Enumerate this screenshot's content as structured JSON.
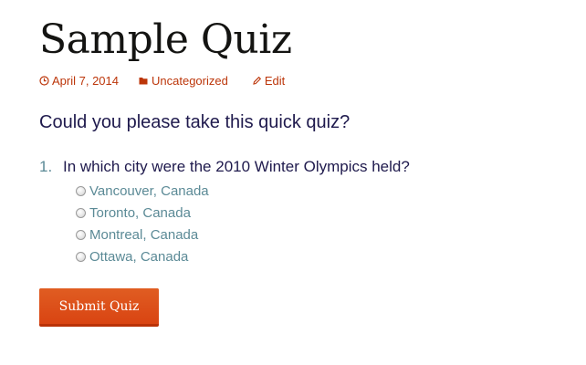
{
  "post": {
    "title": "Sample Quiz",
    "date": "April 7, 2014",
    "category": "Uncategorized",
    "edit_label": "Edit"
  },
  "quiz": {
    "intro": "Could you please take this quick quiz?",
    "questions": [
      {
        "number": "1.",
        "text": "In which city were the 2010 Winter Olympics held?",
        "options": [
          "Vancouver, Canada",
          "Toronto, Canada",
          "Montreal, Canada",
          "Ottawa, Canada"
        ]
      }
    ],
    "submit_label": "Submit Quiz"
  },
  "colors": {
    "link": "#bc360a",
    "heading": "#141412",
    "question_text": "#1f1a4d",
    "option_text": "#5b8a96",
    "button": "#e05d22"
  },
  "icons": {
    "date": "clock-icon",
    "category": "folder-icon",
    "edit": "pencil-icon"
  }
}
